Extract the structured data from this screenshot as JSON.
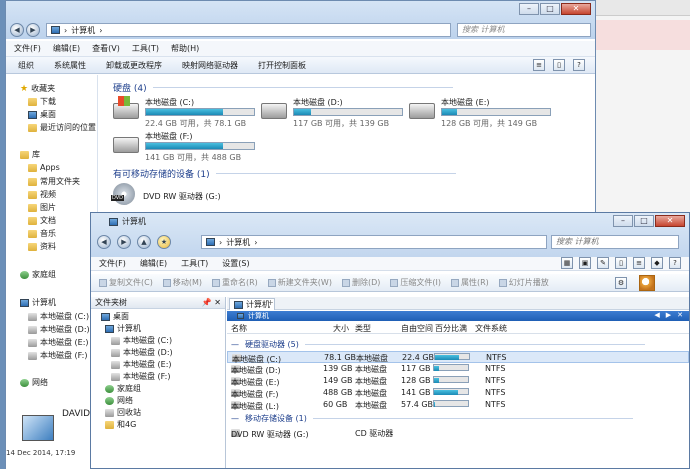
{
  "back_window": {
    "search_placeholder": "搜索 计算机",
    "address": [
      "计算机"
    ],
    "menu": [
      "文件(F)",
      "编辑(E)",
      "查看(V)",
      "工具(T)",
      "帮助(H)"
    ],
    "commands": [
      "组织",
      "系统属性",
      "卸载或更改程序",
      "映射网络驱动器",
      "打开控制面板"
    ],
    "nav": {
      "favorites": "收藏夹",
      "favorite_items": [
        "下载",
        "桌面",
        "最近访问的位置"
      ],
      "libraries": "库",
      "library_items": [
        "Apps",
        "常用文件夹",
        "视频",
        "图片",
        "文档",
        "音乐",
        "资料"
      ],
      "homegroup": "家庭组",
      "computer": "计算机",
      "drives": [
        "本地磁盘 (C:)",
        "本地磁盘 (D:)",
        "本地磁盘 (E:)",
        "本地磁盘 (F:)"
      ],
      "network": "网络"
    },
    "hdd_header": "硬盘 (4)",
    "drives": [
      {
        "name": "本地磁盘 (C:)",
        "info": "22.4 GB 可用，共 78.1 GB",
        "used": 0.71
      },
      {
        "name": "本地磁盘 (D:)",
        "info": "117 GB 可用，共 139 GB",
        "used": 0.16
      },
      {
        "name": "本地磁盘 (E:)",
        "info": "128 GB 可用，共 149 GB",
        "used": 0.14
      },
      {
        "name": "本地磁盘 (F:)",
        "info": "141 GB 可用，共 488 GB",
        "used": 0.71
      }
    ],
    "removable_header": "有可移动存储的设备 (1)",
    "dvd_name": "DVD RW 驱动器 (G:)",
    "dvd_tag": "DVD",
    "bottom_name": "DAVIDZ",
    "date": "14 Dec 2014, 17:19"
  },
  "front_window": {
    "title": "计算机",
    "address": [
      "计算机"
    ],
    "search_placeholder": "搜索 计算机",
    "menu": [
      "文件(F)",
      "编辑(E)",
      "工具(T)",
      "设置(S)"
    ],
    "toolbar": [
      "复制文件(C)",
      "移动(M)",
      "重命名(R)",
      "新建文件夹(W)",
      "删除(D)",
      "压缩文件(I)",
      "属性(R)",
      "幻灯片播放"
    ],
    "left_header": "文件夹树",
    "tree": [
      "桌面",
      "计算机",
      "本地磁盘 (C:)",
      "本地磁盘 (D:)",
      "本地磁盘 (E:)",
      "本地磁盘 (F:)",
      "家庭组",
      "网络",
      "回收站",
      "和4G"
    ],
    "tab_label": "计算机",
    "bluebar_title": "计算机",
    "columns": [
      "名称",
      "大小",
      "类型",
      "自由空间",
      "百分比满",
      "文件系统"
    ],
    "group_hdd": "硬盘驱动器 (5)",
    "rows": [
      {
        "name": "本地磁盘 (C:)",
        "size": "78.1 GB",
        "type": "本地磁盘",
        "free": "22.4 GB",
        "pct": 0.71,
        "fs": "NTFS"
      },
      {
        "name": "本地磁盘 (D:)",
        "size": "139 GB",
        "type": "本地磁盘",
        "free": "117 GB",
        "pct": 0.16,
        "fs": "NTFS"
      },
      {
        "name": "本地磁盘 (E:)",
        "size": "149 GB",
        "type": "本地磁盘",
        "free": "128 GB",
        "pct": 0.14,
        "fs": "NTFS"
      },
      {
        "name": "本地磁盘 (F:)",
        "size": "488 GB",
        "type": "本地磁盘",
        "free": "141 GB",
        "pct": 0.71,
        "fs": "NTFS"
      },
      {
        "name": "本地磁盘 (L:)",
        "size": "60 GB",
        "type": "本地磁盘",
        "free": "57.4 GB",
        "pct": 0.04,
        "fs": "NTFS"
      }
    ],
    "group_removable": "移动存储设备 (1)",
    "removable_row": {
      "name": "DVD RW 驱动器 (G:)",
      "type": "CD 驱动器"
    }
  },
  "colors": {
    "accent": "#1e3f8c",
    "bar_fill": "#1b89b5",
    "blue_bar": "#2a6ac4"
  }
}
